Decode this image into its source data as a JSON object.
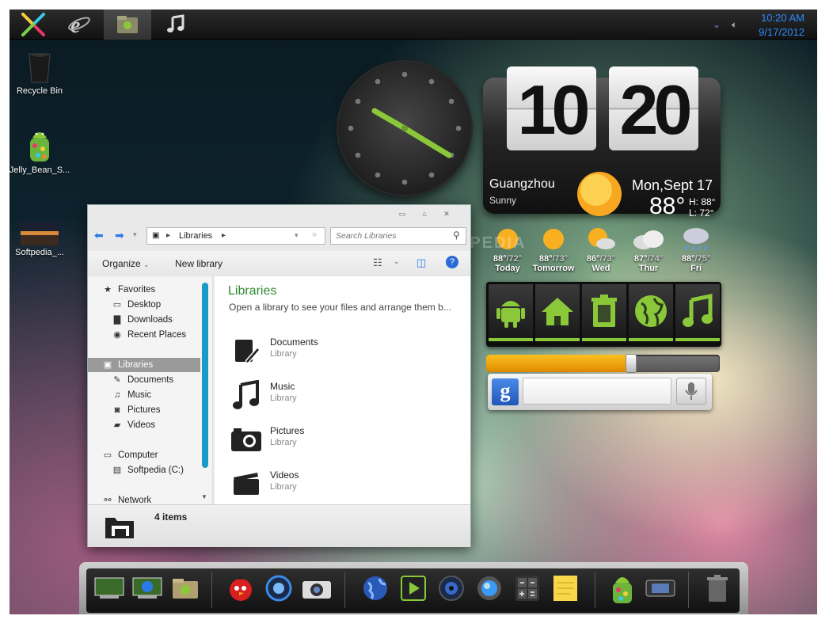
{
  "taskbar": {
    "time": "10:20 AM",
    "date": "9/17/2012",
    "icons": [
      "start-x-icon",
      "internet-explorer-icon",
      "jelly-bean-folder-icon",
      "music-note-icon"
    ]
  },
  "desktop_icons": [
    {
      "label": "Recycle Bin"
    },
    {
      "label": "Jelly_Bean_S..."
    },
    {
      "label": "Softpedia_..."
    }
  ],
  "flip_clock": {
    "hour": "10",
    "minute": "20",
    "city": "Guangzhou",
    "condition": "Sunny",
    "date": "Mon,Sept 17",
    "temp": "88°",
    "high": "H: 88°",
    "low": "L: 72°"
  },
  "forecast": [
    {
      "day": "Today",
      "temp": "88°",
      "low": "/72°",
      "icon": "sun-icon"
    },
    {
      "day": "Tomorrow",
      "temp": "88°",
      "low": "/73°",
      "icon": "sun-icon"
    },
    {
      "day": "Wed",
      "temp": "86°",
      "low": "/73°",
      "icon": "partly-cloudy-icon"
    },
    {
      "day": "Thur",
      "temp": "87°",
      "low": "/74°",
      "icon": "cloud-icon"
    },
    {
      "day": "Fri",
      "temp": "88°",
      "low": "/75°",
      "icon": "rain-cloud-icon"
    }
  ],
  "app_shortcuts": [
    "android-icon",
    "home-icon",
    "trash-icon",
    "globe-icon",
    "music-icon"
  ],
  "slider": {
    "value": 0.62
  },
  "google_search": {
    "logo": "g",
    "placeholder": ""
  },
  "explorer": {
    "address": "Libraries",
    "search_placeholder": "Search Libraries",
    "toolbar": {
      "organize": "Organize",
      "new_library": "New library"
    },
    "nav": {
      "favorites": "Favorites",
      "desktop": "Desktop",
      "downloads": "Downloads",
      "recent": "Recent Places",
      "libraries": "Libraries",
      "documents": "Documents",
      "music": "Music",
      "pictures": "Pictures",
      "videos": "Videos",
      "computer": "Computer",
      "drive": "Softpedia (C:)",
      "network": "Network"
    },
    "header": {
      "title": "Libraries",
      "subtitle": "Open a library to see your files and arrange them b..."
    },
    "libraries": [
      {
        "name": "Documents",
        "type": "Library"
      },
      {
        "name": "Music",
        "type": "Library"
      },
      {
        "name": "Pictures",
        "type": "Library"
      },
      {
        "name": "Videos",
        "type": "Library"
      }
    ],
    "status": "4 items"
  },
  "watermark": "SOFTPEDIA",
  "dock": [
    "desktop-icon",
    "network-desktop-icon",
    "jelly-bean-folder-icon",
    "angry-birds-icon",
    "timer-icon",
    "camera-icon",
    "globe-icon",
    "media-player-icon",
    "speaker-icon",
    "browser-orb-icon",
    "calculator-icon",
    "notes-icon",
    "jelly-bean-icon",
    "slideshow-icon",
    "trash-icon"
  ],
  "colors": {
    "accent": "#2a8cff",
    "green": "#8ac83a",
    "library_title": "#2f8a2f"
  }
}
